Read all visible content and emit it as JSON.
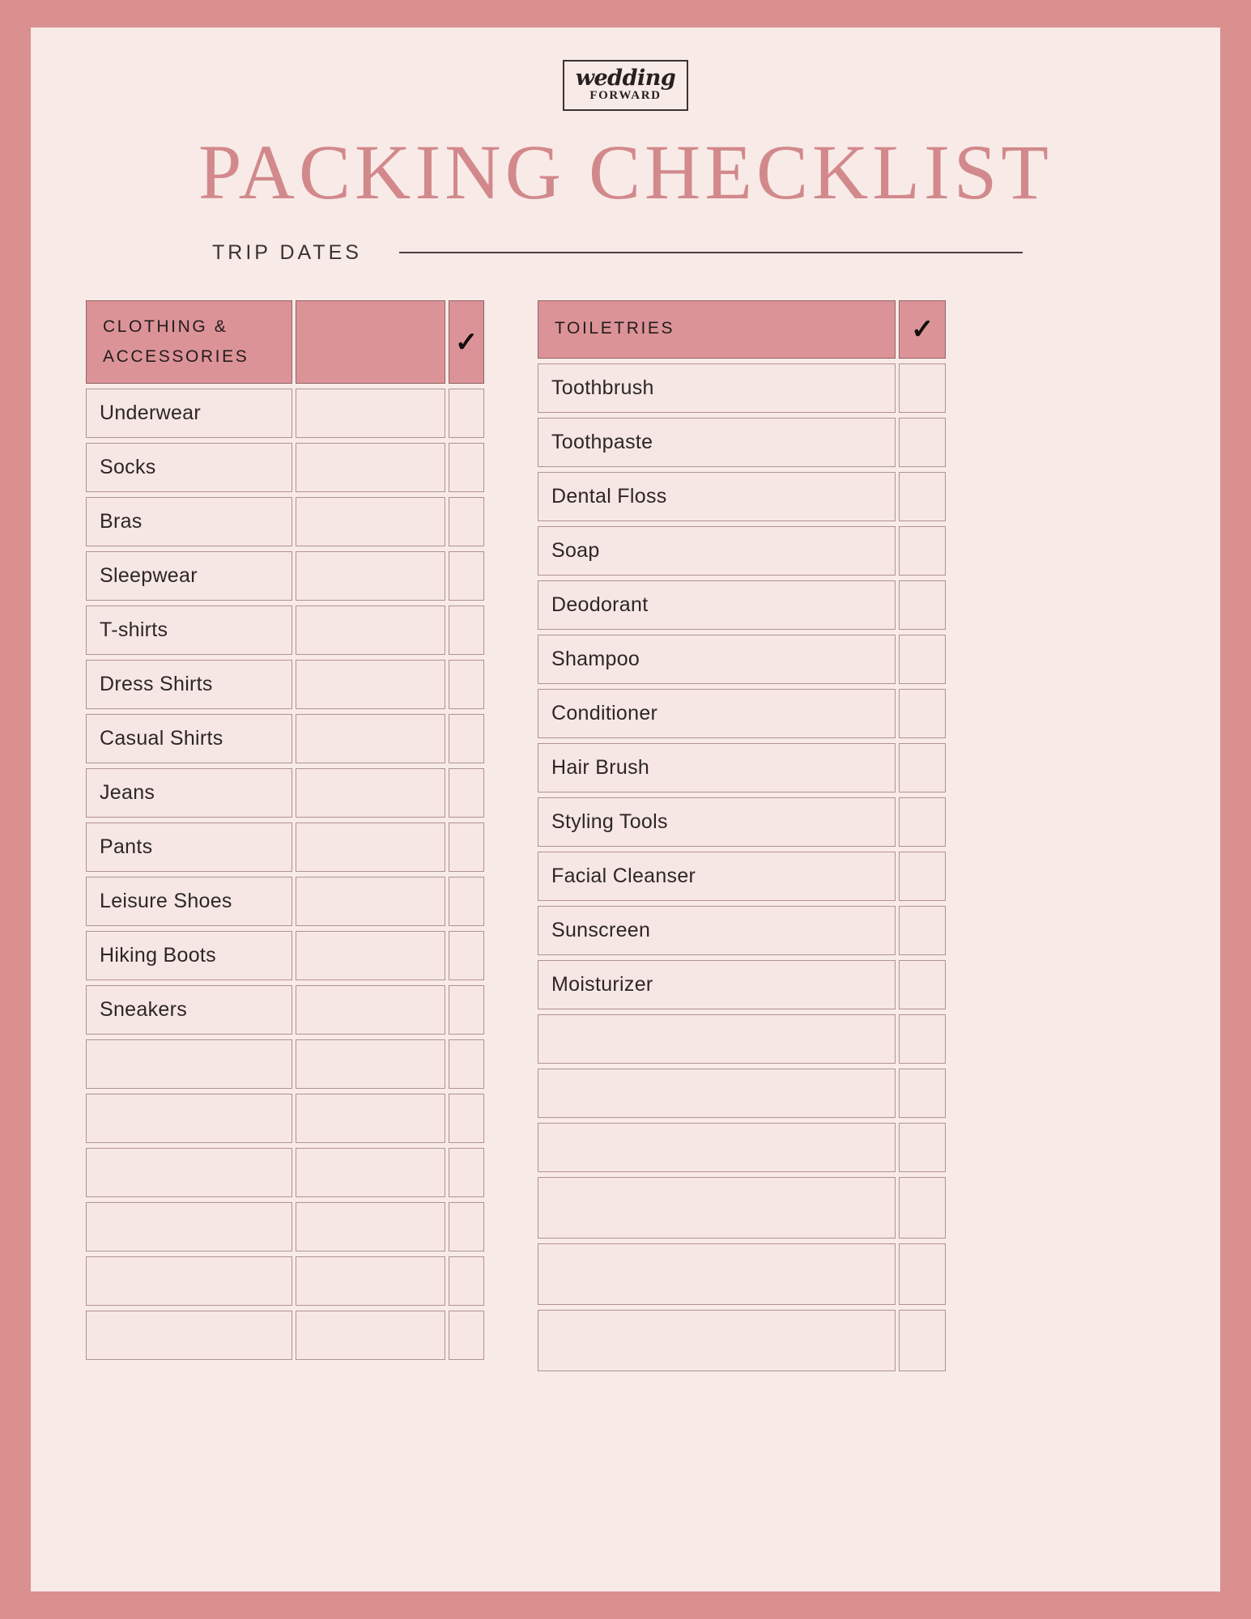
{
  "brand": {
    "logo_script": "wedding",
    "logo_sub": "FORWARD",
    "logo_name": "wedding-forward-logo"
  },
  "header": {
    "title": "PACKING CHECKLIST",
    "trip_dates_label": "TRIP DATES",
    "trip_dates_value": ""
  },
  "colors": {
    "frame": "#d9908f",
    "sheet": "#f8eae7",
    "title": "#d2898c",
    "header_fill": "#dc9397",
    "cell_fill": "#f6e7e4",
    "cell_border": "#b09292",
    "text": "#2d2626"
  },
  "tables": [
    {
      "id": "clothing-accessories",
      "header": {
        "label": "CLOTHING & ACCESSORIES",
        "line1": "CLOTHING &",
        "line2": "ACCESSORIES",
        "notes_label": "",
        "check_label": "✓"
      },
      "columns": [
        "CLOTHING & ACCESSORIES",
        "",
        "✓"
      ],
      "rows": [
        "Underwear",
        "Socks",
        "Bras",
        "Sleepwear",
        "T-shirts",
        "Dress Shirts",
        "Casual Shirts",
        "Jeans",
        "Pants",
        "Leisure Shoes",
        "Hiking Boots",
        "Sneakers",
        "",
        "",
        "",
        "",
        "",
        ""
      ]
    },
    {
      "id": "toiletries",
      "header": {
        "label": "TOILETRIES",
        "line1": "TOILETRIES",
        "line2": "",
        "check_label": "✓"
      },
      "columns": [
        "TOILETRIES",
        "✓"
      ],
      "rows": [
        "Toothbrush",
        "Toothpaste",
        "Dental Floss",
        "Soap",
        "Deodorant",
        "Shampoo",
        "Conditioner",
        "Hair Brush",
        "Styling Tools",
        "Facial Cleanser",
        "Sunscreen",
        "Moisturizer",
        "",
        "",
        "",
        "",
        "",
        ""
      ]
    }
  ]
}
